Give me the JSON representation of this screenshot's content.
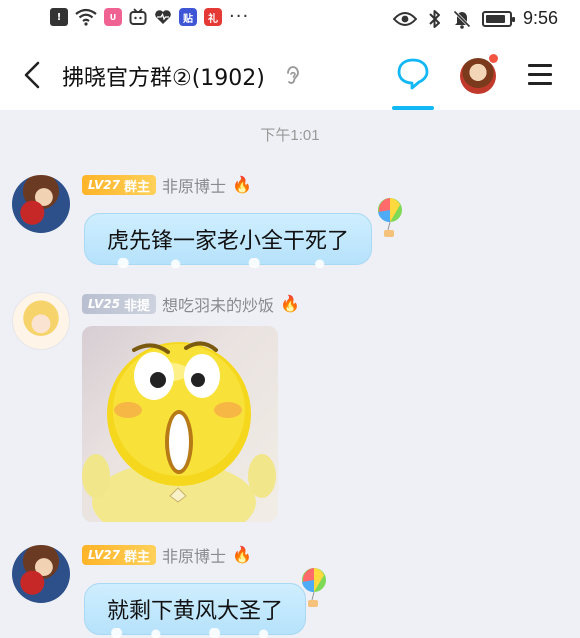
{
  "status_bar": {
    "time": "9:56",
    "left_icons": [
      "alert-icon",
      "wifi-icon",
      "app-badge-icon",
      "tv-icon",
      "heart-pulse-icon",
      "tieba-icon",
      "gift-icon"
    ],
    "overflow": "···",
    "right_icons": [
      "eye-icon",
      "bluetooth-icon",
      "bell-off-icon",
      "battery-icon"
    ],
    "battery_level": 0.85
  },
  "header": {
    "title": "拂晓官方群②(1902)",
    "back_icon": "chevron-left-icon",
    "ear_icon": "ear-icon",
    "chat_icon": "chat-bubble-icon",
    "menu_icon": "hamburger-menu-icon",
    "accent": "#12b7f5"
  },
  "timestamp": "下午1:01",
  "messages": [
    {
      "level": "LV27",
      "role": "群主",
      "nickname": "非原博士",
      "text": "虎先锋一家老小全干死了"
    },
    {
      "level": "LV25",
      "role": "非提",
      "nickname": "想吃羽未的炒饭",
      "sticker": "surprised-emoji-sticker"
    },
    {
      "level": "LV27",
      "role": "群主",
      "nickname": "非原博士",
      "text": "就剩下黄风大圣了"
    }
  ],
  "colors": {
    "owner_badge": "#ffb428",
    "member_badge": "#b9bfd0",
    "bubble": "#c4e8fc",
    "background": "#eef0f5"
  }
}
